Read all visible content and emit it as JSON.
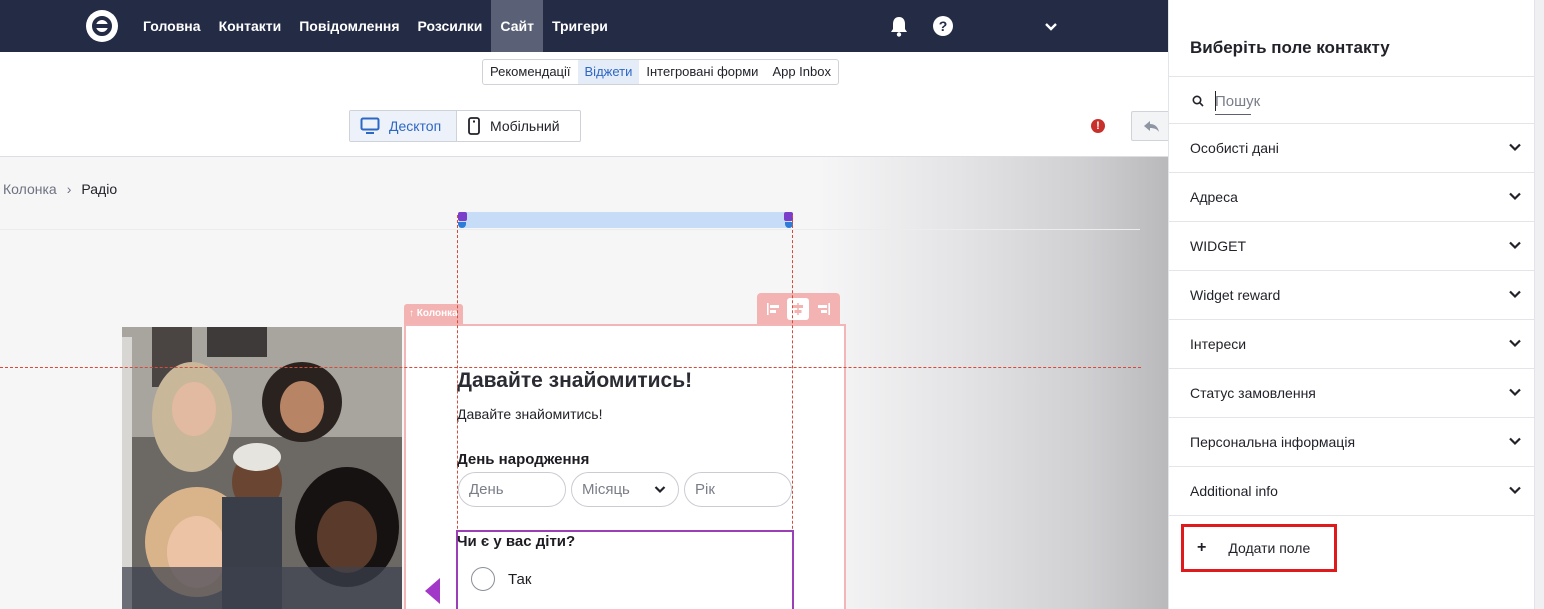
{
  "topnav": {
    "items": [
      {
        "label": "Головна",
        "active": false
      },
      {
        "label": "Контакти",
        "active": false
      },
      {
        "label": "Повідомлення",
        "active": false
      },
      {
        "label": "Розсилки",
        "active": false
      },
      {
        "label": "Сайт",
        "active": true
      },
      {
        "label": "Тригери",
        "active": false
      }
    ],
    "help_glyph": "?",
    "icons": [
      "logo-icon",
      "bell-icon",
      "help-icon",
      "chevron-down-icon"
    ]
  },
  "subtabs": [
    {
      "label": "Рекомендації",
      "active": false
    },
    {
      "label": "Віджети",
      "active": true
    },
    {
      "label": "Інтегровані форми",
      "active": false
    },
    {
      "label": "App Inbox",
      "active": false
    }
  ],
  "devices": {
    "desktop_label": "Десктоп",
    "mobile_label": "Мобільний",
    "selected": "Десктоп"
  },
  "warning_glyph": "!",
  "breadcrumb": {
    "parent": "Колонка",
    "separator": "›",
    "current": "Радіо"
  },
  "canvas": {
    "column_tag": "↑ Колонка",
    "form": {
      "title": "Давайте знайомитись!",
      "subtitle": "Давайте знайомитись!",
      "birthday_label": "День народження",
      "day_placeholder": "День",
      "month_placeholder": "Місяць",
      "year_placeholder": "Рік",
      "radio_question": "Чи є у вас діти?",
      "radio_option": "Так"
    }
  },
  "panel": {
    "title": "Виберіть поле контакту",
    "search_placeholder": "Пошук",
    "sections": [
      "Особисті дані",
      "Адреса",
      "WIDGET",
      "Widget reward",
      "Інтереси",
      "Статус замовлення",
      "Персональна інформація",
      "Additional info"
    ],
    "add_button": {
      "plus": "+",
      "label": "Додати поле"
    }
  },
  "colors": {
    "nav_bg": "#232b45",
    "accent_blue": "#2d67c4",
    "highlight_red": "#e0191d",
    "selection_purple": "#9a3fb5"
  }
}
